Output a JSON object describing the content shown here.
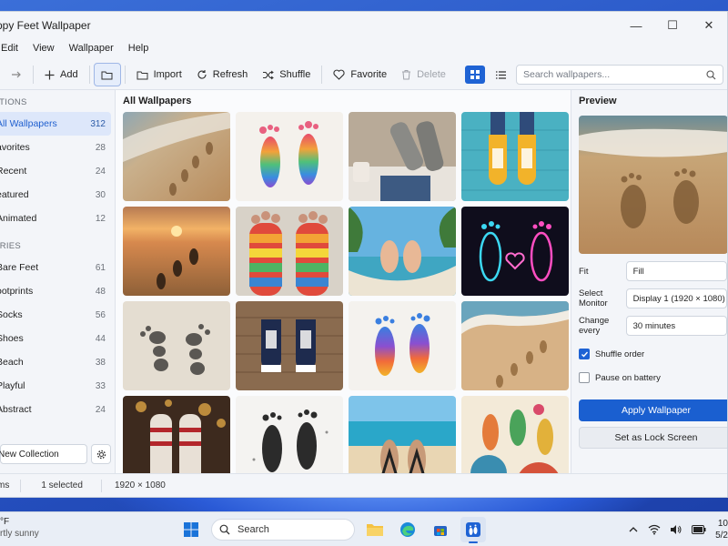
{
  "window": {
    "title": "ppy Feet Wallpaper",
    "minimize_glyph": "—",
    "maximize_glyph": "☐",
    "close_glyph": "✕"
  },
  "menu": [
    "Edit",
    "View",
    "Wallpaper",
    "Help"
  ],
  "toolbar": {
    "add": "Add",
    "import": "Import",
    "refresh": "Refresh",
    "shuffle": "Shuffle",
    "favorite": "Favorite",
    "delete": "Delete",
    "search_placeholder": "Search wallpapers..."
  },
  "sidebar": {
    "collections_heading": "CTIONS",
    "collections": [
      {
        "label": "All Wallpapers",
        "count": "312",
        "active": true
      },
      {
        "label": "avorites",
        "count": "28"
      },
      {
        "label": "Recent",
        "count": "24"
      },
      {
        "label": "eatured",
        "count": "30"
      },
      {
        "label": "Animated",
        "count": "12"
      }
    ],
    "categories_heading": "ORIES",
    "categories": [
      {
        "label": "Bare Feet",
        "count": "61"
      },
      {
        "label": "ootprints",
        "count": "48"
      },
      {
        "label": "Socks",
        "count": "56"
      },
      {
        "label": "Shoes",
        "count": "44"
      },
      {
        "label": "Beach",
        "count": "38"
      },
      {
        "label": "Playful",
        "count": "33"
      },
      {
        "label": "Abstract",
        "count": "24"
      }
    ],
    "new_collection": "New Collection"
  },
  "main": {
    "title": "All Wallpapers",
    "thumbnails": [
      "beach-footprints-sunset",
      "watercolor-rainbow-footprints",
      "wool-socks-by-fire",
      "yellow-sneakers-on-teal-boards",
      "footprints-at-sunset",
      "striped-rainbow-socks",
      "bare-feet-in-hammock",
      "neon-footprints-heart",
      "pebble-footprints",
      "navy-sneakers-on-wood",
      "paint-splash-footprints",
      "beach-footprints-waves",
      "christmas-socks-by-fire",
      "black-ink-footprints",
      "flip-flops-tropical-sea",
      "colorful-abstract-feet"
    ]
  },
  "preview": {
    "title": "Preview",
    "fit_label": "Fit",
    "fit_value": "Fill",
    "monitor_label": "Select Monitor",
    "monitor_value": "Display 1 (1920 × 1080)",
    "interval_label": "Change every",
    "interval_value": "30 minutes",
    "shuffle_label": "Shuffle order",
    "shuffle_checked": true,
    "battery_label": "Pause on battery",
    "battery_checked": false,
    "apply": "Apply Wallpaper",
    "lock": "Set as Lock Screen"
  },
  "status": {
    "items": "ms",
    "selected": "1 selected",
    "resolution": "1920 × 1080"
  },
  "taskbar": {
    "temp": "°F",
    "condition": "rtly sunny",
    "search": "Search",
    "time": "10",
    "date": "5/2"
  },
  "colors": {
    "accent": "#1f63d4",
    "apply_button": "#1a5fd0"
  }
}
